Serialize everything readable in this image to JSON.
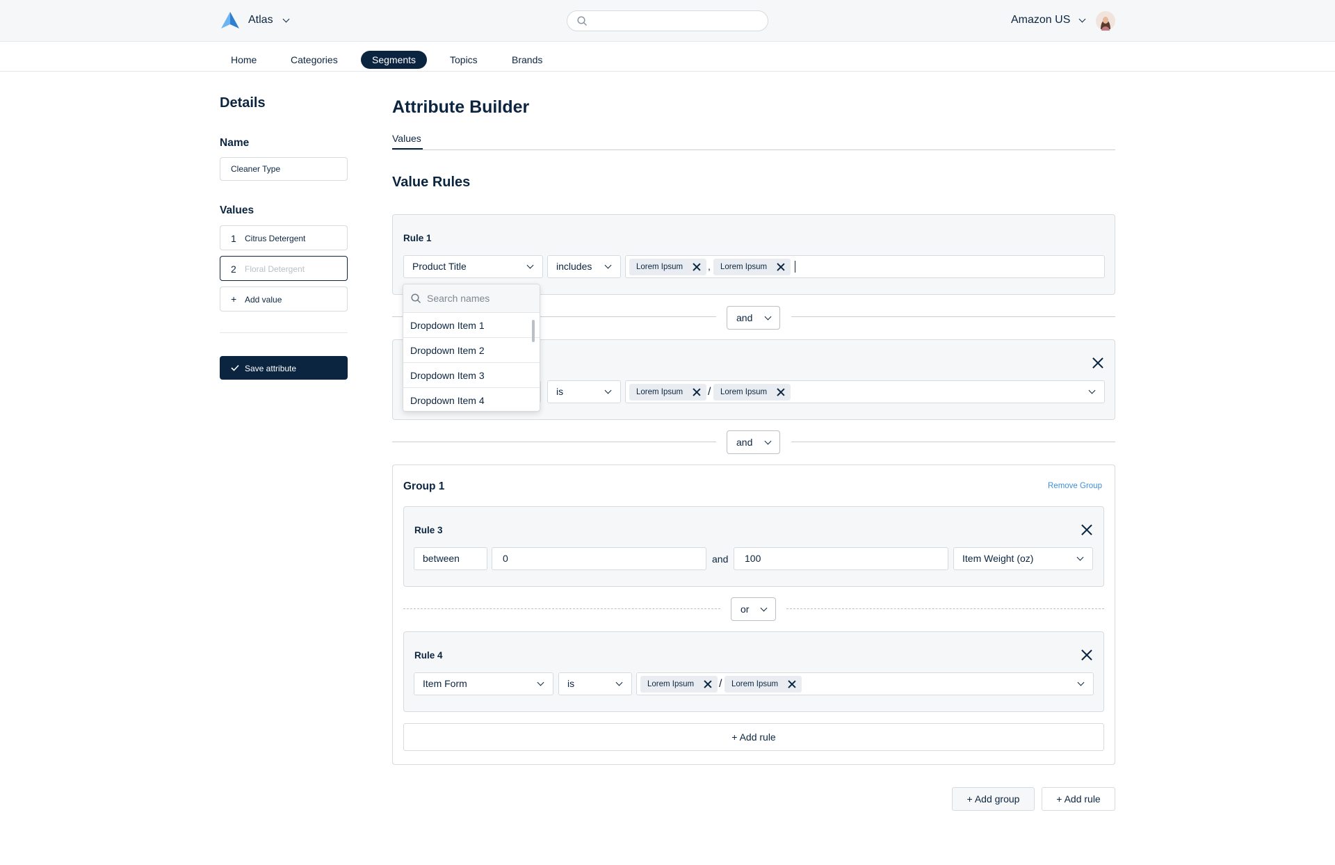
{
  "header": {
    "app_name": "Atlas",
    "search_placeholder": "",
    "marketplace": "Amazon US",
    "brand_color": "#4a9fe8"
  },
  "nav": {
    "items": [
      "Home",
      "Categories",
      "Segments",
      "Topics",
      "Brands"
    ],
    "active": "Segments"
  },
  "details": {
    "heading": "Details",
    "name_label": "Name",
    "name_value": "Cleaner Type",
    "values_label": "Values",
    "values": [
      {
        "num": "1",
        "text": "Citrus Detergent"
      },
      {
        "num": "2",
        "placeholder": "Floral Detergent"
      }
    ],
    "add_value_icon": "+",
    "add_value_label": "Add value",
    "save_label": "Save attribute"
  },
  "builder": {
    "title": "Attribute Builder",
    "tab": "Values",
    "section_title": "Value Rules"
  },
  "rule1": {
    "title": "Rule 1",
    "field": "Product Title",
    "operator": "includes",
    "chips": [
      "Lorem Ipsum",
      "Lorem Ipsum"
    ],
    "separator": ","
  },
  "dropdown": {
    "search_placeholder": "Search names",
    "items": [
      "Dropdown Item 1",
      "Dropdown Item 2",
      "Dropdown Item 3",
      "Dropdown Item 4"
    ]
  },
  "connector1": "and",
  "rule2": {
    "operator": "is",
    "chips": [
      "Lorem Ipsum",
      "Lorem Ipsum"
    ],
    "separator": "/"
  },
  "connector2": "and",
  "group1": {
    "title": "Group 1",
    "remove_label": "Remove Group",
    "rule3": {
      "title": "Rule 3",
      "operator": "between",
      "min": "0",
      "and_label": "and",
      "max": "100",
      "field": "Item Weight (oz)"
    },
    "connector": "or",
    "rule4": {
      "title": "Rule 4",
      "field": "Item Form",
      "operator": "is",
      "chips": [
        "Lorem Ipsum",
        "Lorem Ipsum"
      ],
      "separator": "/"
    },
    "add_rule_label": "+ Add rule"
  },
  "footer": {
    "add_group_label": "+ Add group",
    "add_rule_label": "+ Add rule"
  }
}
